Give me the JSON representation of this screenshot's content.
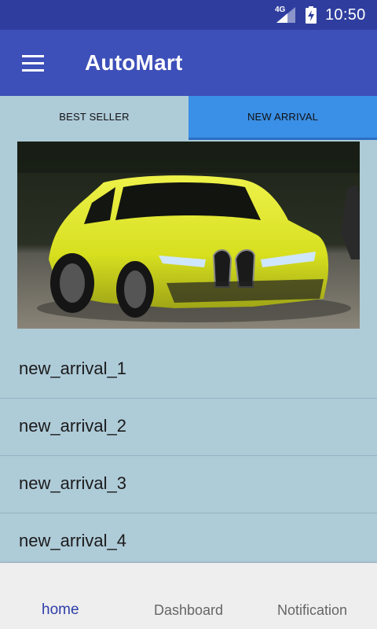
{
  "status_bar": {
    "network": "4G",
    "time": "10:50"
  },
  "app_bar": {
    "title": "AutoMart",
    "menu_icon": "hamburger-menu-icon"
  },
  "tabs": [
    {
      "label": "BEST SELLER",
      "selected": false
    },
    {
      "label": "NEW ARRIVAL",
      "selected": true
    }
  ],
  "colors": {
    "status_bar": "#2f3e9e",
    "app_bar": "#3d4fb8",
    "tab_selected": "#3a8fe6",
    "content_bg": "#aecbd8",
    "nav_active": "#2f3ea8"
  },
  "featured_image": {
    "subject": "yellow sports car"
  },
  "list": [
    {
      "label": "new_arrival_1"
    },
    {
      "label": "new_arrival_2"
    },
    {
      "label": "new_arrival_3"
    },
    {
      "label": "new_arrival_4"
    }
  ],
  "bottom_nav": [
    {
      "label": "home",
      "active": true
    },
    {
      "label": "Dashboard",
      "active": false
    },
    {
      "label": "Notification",
      "active": false
    }
  ]
}
